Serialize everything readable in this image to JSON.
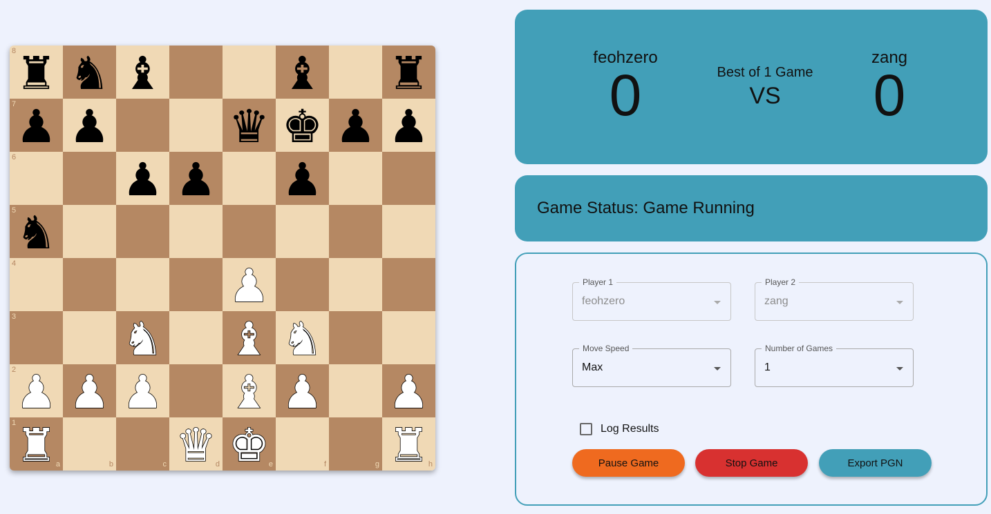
{
  "board": {
    "ranks": [
      "8",
      "7",
      "6",
      "5",
      "4",
      "3",
      "2",
      "1"
    ],
    "files": [
      "a",
      "b",
      "c",
      "d",
      "e",
      "f",
      "g",
      "h"
    ],
    "rows": [
      [
        "br",
        "bn",
        "bb",
        "",
        "",
        "bb",
        "",
        "br"
      ],
      [
        "bp",
        "bp",
        "",
        "",
        "bq",
        "bk",
        "bp",
        "bp"
      ],
      [
        "",
        "",
        "bp",
        "bp",
        "",
        "bp",
        "",
        ""
      ],
      [
        "bn",
        "",
        "",
        "",
        "",
        "",
        "",
        ""
      ],
      [
        "",
        "",
        "",
        "",
        "wp",
        "",
        "",
        ""
      ],
      [
        "",
        "",
        "wn",
        "",
        "wb",
        "wn",
        "",
        ""
      ],
      [
        "wp",
        "wp",
        "wp",
        "",
        "wb",
        "wp",
        "",
        "wp"
      ],
      [
        "wr",
        "",
        "",
        "wq",
        "wk",
        "",
        "",
        "wr"
      ]
    ],
    "colors": {
      "light": "#f0d9b5",
      "dark": "#b58863"
    }
  },
  "scoreboard": {
    "player1_name": "feohzero",
    "player1_score": "0",
    "player2_name": "zang",
    "player2_score": "0",
    "match_label": "Best of 1 Game",
    "vs_label": "VS"
  },
  "status": {
    "text": "Game Status: Game Running"
  },
  "controls": {
    "player1": {
      "label": "Player 1",
      "value": "feohzero"
    },
    "player2": {
      "label": "Player 2",
      "value": "zang"
    },
    "move_speed": {
      "label": "Move Speed",
      "value": "Max"
    },
    "num_games": {
      "label": "Number of Games",
      "value": "1"
    },
    "log_results": {
      "label": "Log Results",
      "checked": false
    },
    "pause_button": "Pause Game",
    "stop_button": "Stop Game",
    "export_button": "Export PGN"
  },
  "theme": {
    "accent": "#429fb8",
    "pause": "#ef6a1f",
    "stop": "#d83130",
    "background": "#eef2fd"
  }
}
